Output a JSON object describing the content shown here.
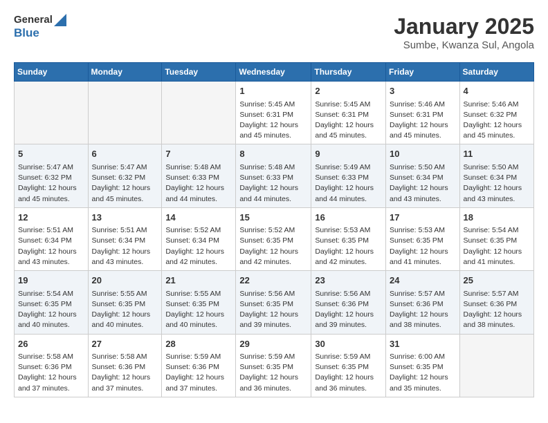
{
  "logo": {
    "general": "General",
    "blue": "Blue"
  },
  "header": {
    "title": "January 2025",
    "subtitle": "Sumbe, Kwanza Sul, Angola"
  },
  "weekdays": [
    "Sunday",
    "Monday",
    "Tuesday",
    "Wednesday",
    "Thursday",
    "Friday",
    "Saturday"
  ],
  "weeks": [
    [
      {
        "day": "",
        "info": ""
      },
      {
        "day": "",
        "info": ""
      },
      {
        "day": "",
        "info": ""
      },
      {
        "day": "1",
        "info": "Sunrise: 5:45 AM\nSunset: 6:31 PM\nDaylight: 12 hours\nand 45 minutes."
      },
      {
        "day": "2",
        "info": "Sunrise: 5:45 AM\nSunset: 6:31 PM\nDaylight: 12 hours\nand 45 minutes."
      },
      {
        "day": "3",
        "info": "Sunrise: 5:46 AM\nSunset: 6:31 PM\nDaylight: 12 hours\nand 45 minutes."
      },
      {
        "day": "4",
        "info": "Sunrise: 5:46 AM\nSunset: 6:32 PM\nDaylight: 12 hours\nand 45 minutes."
      }
    ],
    [
      {
        "day": "5",
        "info": "Sunrise: 5:47 AM\nSunset: 6:32 PM\nDaylight: 12 hours\nand 45 minutes."
      },
      {
        "day": "6",
        "info": "Sunrise: 5:47 AM\nSunset: 6:32 PM\nDaylight: 12 hours\nand 45 minutes."
      },
      {
        "day": "7",
        "info": "Sunrise: 5:48 AM\nSunset: 6:33 PM\nDaylight: 12 hours\nand 44 minutes."
      },
      {
        "day": "8",
        "info": "Sunrise: 5:48 AM\nSunset: 6:33 PM\nDaylight: 12 hours\nand 44 minutes."
      },
      {
        "day": "9",
        "info": "Sunrise: 5:49 AM\nSunset: 6:33 PM\nDaylight: 12 hours\nand 44 minutes."
      },
      {
        "day": "10",
        "info": "Sunrise: 5:50 AM\nSunset: 6:34 PM\nDaylight: 12 hours\nand 43 minutes."
      },
      {
        "day": "11",
        "info": "Sunrise: 5:50 AM\nSunset: 6:34 PM\nDaylight: 12 hours\nand 43 minutes."
      }
    ],
    [
      {
        "day": "12",
        "info": "Sunrise: 5:51 AM\nSunset: 6:34 PM\nDaylight: 12 hours\nand 43 minutes."
      },
      {
        "day": "13",
        "info": "Sunrise: 5:51 AM\nSunset: 6:34 PM\nDaylight: 12 hours\nand 43 minutes."
      },
      {
        "day": "14",
        "info": "Sunrise: 5:52 AM\nSunset: 6:34 PM\nDaylight: 12 hours\nand 42 minutes."
      },
      {
        "day": "15",
        "info": "Sunrise: 5:52 AM\nSunset: 6:35 PM\nDaylight: 12 hours\nand 42 minutes."
      },
      {
        "day": "16",
        "info": "Sunrise: 5:53 AM\nSunset: 6:35 PM\nDaylight: 12 hours\nand 42 minutes."
      },
      {
        "day": "17",
        "info": "Sunrise: 5:53 AM\nSunset: 6:35 PM\nDaylight: 12 hours\nand 41 minutes."
      },
      {
        "day": "18",
        "info": "Sunrise: 5:54 AM\nSunset: 6:35 PM\nDaylight: 12 hours\nand 41 minutes."
      }
    ],
    [
      {
        "day": "19",
        "info": "Sunrise: 5:54 AM\nSunset: 6:35 PM\nDaylight: 12 hours\nand 40 minutes."
      },
      {
        "day": "20",
        "info": "Sunrise: 5:55 AM\nSunset: 6:35 PM\nDaylight: 12 hours\nand 40 minutes."
      },
      {
        "day": "21",
        "info": "Sunrise: 5:55 AM\nSunset: 6:35 PM\nDaylight: 12 hours\nand 40 minutes."
      },
      {
        "day": "22",
        "info": "Sunrise: 5:56 AM\nSunset: 6:35 PM\nDaylight: 12 hours\nand 39 minutes."
      },
      {
        "day": "23",
        "info": "Sunrise: 5:56 AM\nSunset: 6:36 PM\nDaylight: 12 hours\nand 39 minutes."
      },
      {
        "day": "24",
        "info": "Sunrise: 5:57 AM\nSunset: 6:36 PM\nDaylight: 12 hours\nand 38 minutes."
      },
      {
        "day": "25",
        "info": "Sunrise: 5:57 AM\nSunset: 6:36 PM\nDaylight: 12 hours\nand 38 minutes."
      }
    ],
    [
      {
        "day": "26",
        "info": "Sunrise: 5:58 AM\nSunset: 6:36 PM\nDaylight: 12 hours\nand 37 minutes."
      },
      {
        "day": "27",
        "info": "Sunrise: 5:58 AM\nSunset: 6:36 PM\nDaylight: 12 hours\nand 37 minutes."
      },
      {
        "day": "28",
        "info": "Sunrise: 5:59 AM\nSunset: 6:36 PM\nDaylight: 12 hours\nand 37 minutes."
      },
      {
        "day": "29",
        "info": "Sunrise: 5:59 AM\nSunset: 6:35 PM\nDaylight: 12 hours\nand 36 minutes."
      },
      {
        "day": "30",
        "info": "Sunrise: 5:59 AM\nSunset: 6:35 PM\nDaylight: 12 hours\nand 36 minutes."
      },
      {
        "day": "31",
        "info": "Sunrise: 6:00 AM\nSunset: 6:35 PM\nDaylight: 12 hours\nand 35 minutes."
      },
      {
        "day": "",
        "info": ""
      }
    ]
  ]
}
